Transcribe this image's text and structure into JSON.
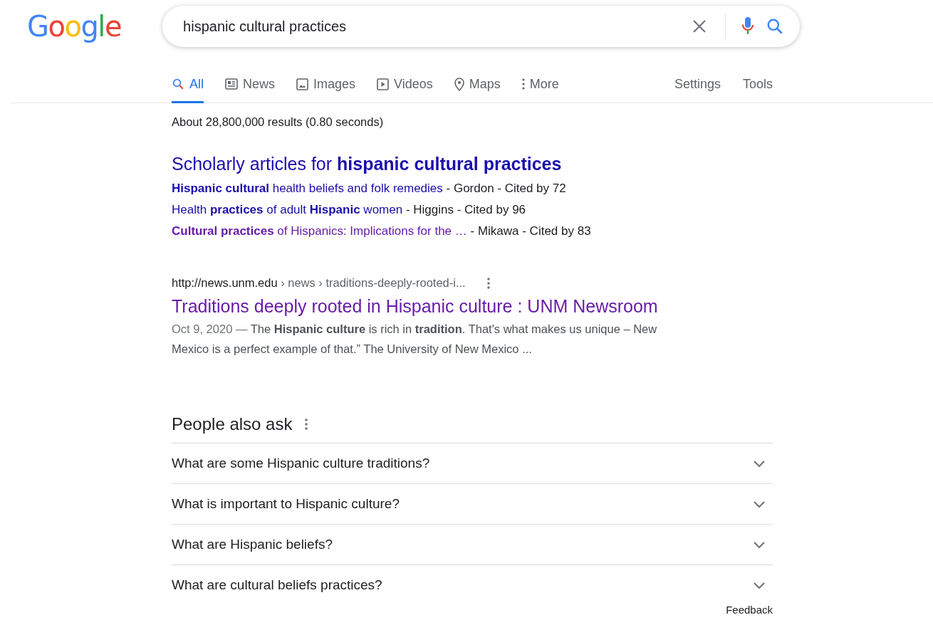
{
  "logo": "Google",
  "search": {
    "value": "hispanic cultural practices"
  },
  "tabs": [
    {
      "label": "All",
      "selected": true
    },
    {
      "label": "News",
      "selected": false
    },
    {
      "label": "Images",
      "selected": false
    },
    {
      "label": "Videos",
      "selected": false
    },
    {
      "label": "Maps",
      "selected": false
    },
    {
      "label": "More",
      "selected": false
    }
  ],
  "tools": [
    "Settings",
    "Tools"
  ],
  "result_stats": "About 28,800,000 results (0.80 seconds)",
  "scholarly": {
    "heading": "Scholarly articles for **hispanic cultural practices**",
    "articles": [
      {
        "title": "**Hispanic cultural** health beliefs and folk remedies",
        "meta": " - Gordon - Cited by 72",
        "visited": false
      },
      {
        "title": "Health **practices** of adult **Hispanic** women",
        "meta": " - Higgins - Cited by 96",
        "visited": false
      },
      {
        "title": "**Cultural practices** of Hispanics: Implications for the …",
        "meta": " - Mikawa - Cited by 83",
        "visited": true
      }
    ]
  },
  "result": {
    "host": "http://news.unm.edu",
    "path": " › news › traditions-deeply-rooted-i...",
    "title": "Traditions deeply rooted in Hispanic culture : UNM Newsroom",
    "visited": true,
    "date": "Oct 9, 2020 —",
    "snippet": "The **Hispanic culture** is rich in **tradition**. That's what makes us unique – New Mexico is a perfect example of that.” The University of New Mexico ..."
  },
  "people_also_ask": {
    "heading": "People also ask",
    "questions": [
      {
        "text": "What are some Hispanic culture traditions?",
        "expanded": false
      },
      {
        "text": "What is important to Hispanic culture?",
        "expanded": false
      },
      {
        "text": "What are Hispanic beliefs?",
        "expanded": false
      },
      {
        "text": "What are cultural beliefs practices?",
        "expanded": false
      }
    ]
  },
  "feedback": "Feedback"
}
